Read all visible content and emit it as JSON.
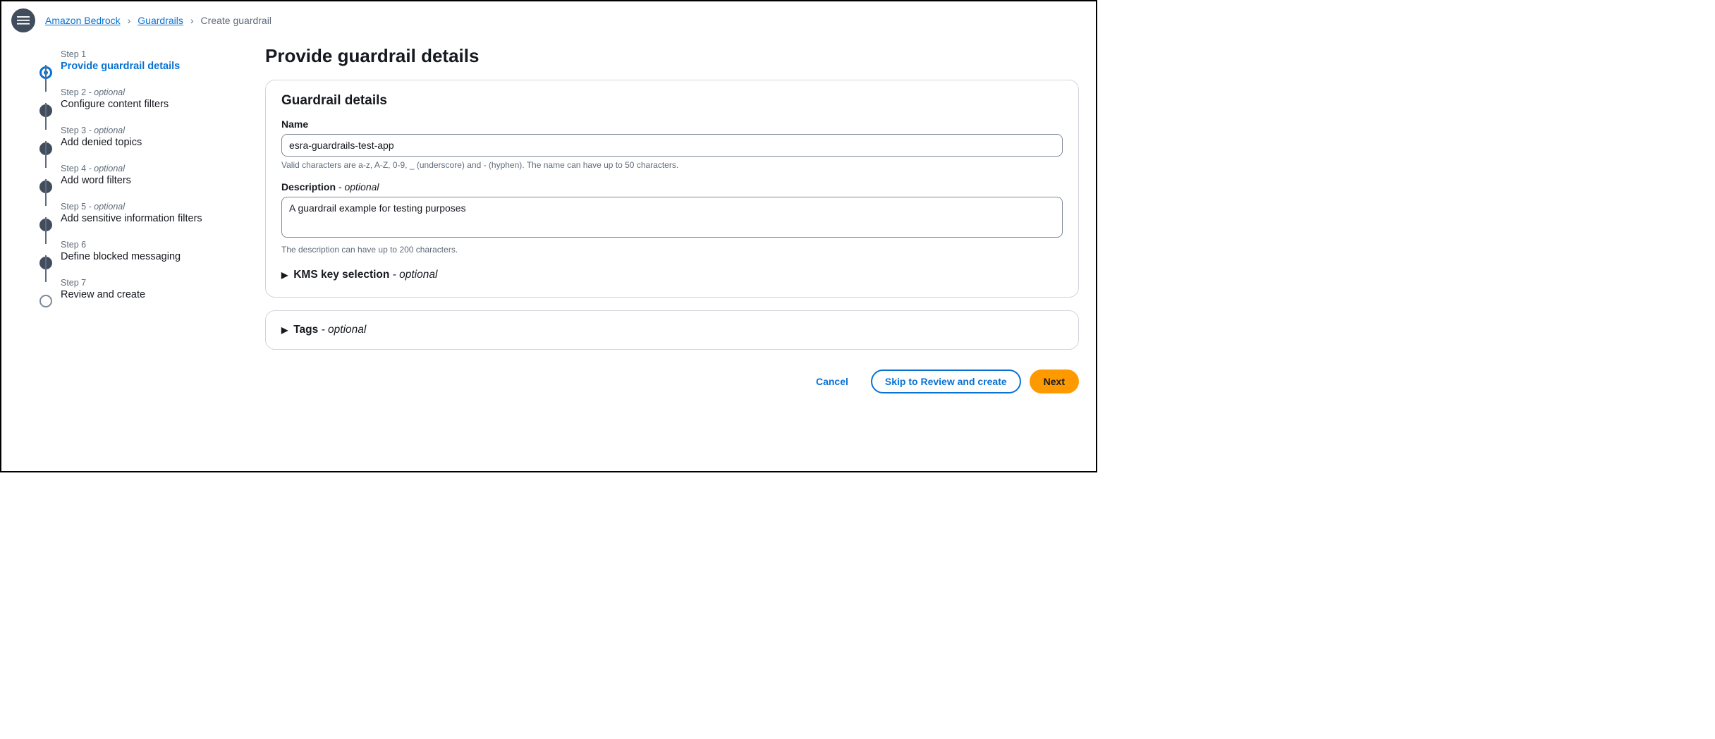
{
  "breadcrumb": {
    "root": "Amazon Bedrock",
    "mid": "Guardrails",
    "current": "Create guardrail"
  },
  "stepper": [
    {
      "heading": "Step 1",
      "optional": false,
      "title": "Provide guardrail details",
      "state": "active"
    },
    {
      "heading": "Step 2",
      "optional": true,
      "title": "Configure content filters",
      "state": "done"
    },
    {
      "heading": "Step 3",
      "optional": true,
      "title": "Add denied topics",
      "state": "done"
    },
    {
      "heading": "Step 4",
      "optional": true,
      "title": "Add word filters",
      "state": "done"
    },
    {
      "heading": "Step 5",
      "optional": true,
      "title": "Add sensitive information filters",
      "state": "done"
    },
    {
      "heading": "Step 6",
      "optional": false,
      "title": "Define blocked messaging",
      "state": "done"
    },
    {
      "heading": "Step 7",
      "optional": false,
      "title": "Review and create",
      "state": "pending"
    }
  ],
  "page_title": "Provide guardrail details",
  "panel_title": "Guardrail details",
  "fields": {
    "name_label": "Name",
    "name_value": "esra-guardrails-test-app",
    "name_hint": "Valid characters are a-z, A-Z, 0-9, _ (underscore) and - (hyphen). The name can have up to 50 characters.",
    "desc_label": "Description",
    "desc_value": "A guardrail example for testing purposes",
    "desc_hint": "The description can have up to 200 characters.",
    "kms_label": "KMS key selection",
    "tags_label": "Tags"
  },
  "optional_suffix": " - optional",
  "buttons": {
    "cancel": "Cancel",
    "skip": "Skip to Review and create",
    "next": "Next"
  }
}
